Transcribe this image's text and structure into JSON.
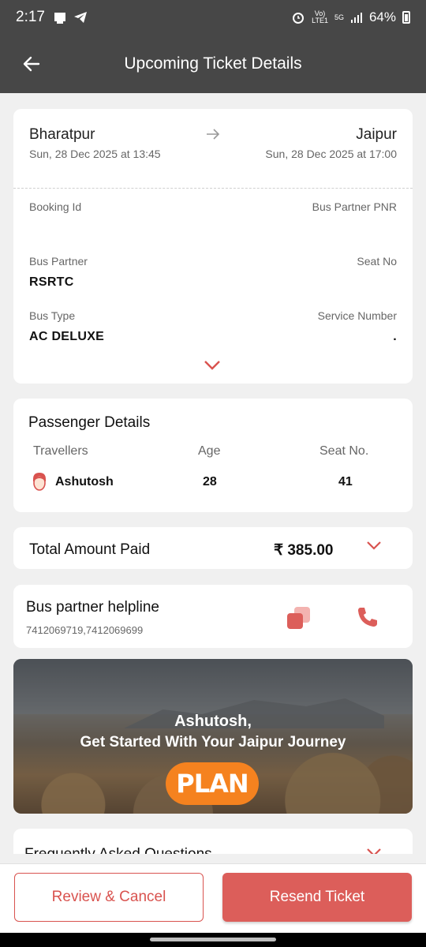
{
  "status": {
    "time": "2:17",
    "battery": "64%",
    "net_top": "Vo)",
    "net_bottom": "LTE1",
    "gen": "5G"
  },
  "header": {
    "title": "Upcoming Ticket Details"
  },
  "journey": {
    "from_city": "Bharatpur",
    "from_datetime": "Sun, 28 Dec 2025 at 13:45",
    "to_city": "Jaipur",
    "to_datetime": "Sun, 28 Dec 2025 at 17:00",
    "booking_id_label": "Booking Id",
    "booking_id_value": "",
    "pnr_label": "Bus Partner PNR",
    "pnr_value": "",
    "partner_label": "Bus Partner",
    "partner_value": "RSRTC",
    "seat_label": "Seat No",
    "seat_value": "",
    "bus_type_label": "Bus Type",
    "bus_type_value": "AC DELUXE",
    "service_label": "Service Number",
    "service_value": "."
  },
  "passenger": {
    "title": "Passenger Details",
    "col_travellers": "Travellers",
    "col_age": "Age",
    "col_seat": "Seat No.",
    "rows": [
      {
        "name": "Ashutosh",
        "age": "28",
        "seat": "41"
      }
    ]
  },
  "payment": {
    "label": "Total Amount Paid",
    "amount": "₹ 385.00"
  },
  "helpline": {
    "label": "Bus partner helpline",
    "numbers": "7412069719,7412069699"
  },
  "banner": {
    "name": "Ashutosh,",
    "text": "Get Started With Your Jaipur Journey",
    "button": "PLAN"
  },
  "faq": {
    "title": "Frequently Asked Questions"
  },
  "actions": {
    "cancel": "Review & Cancel",
    "resend": "Resend Ticket"
  },
  "colors": {
    "accent": "#dc5e5a",
    "header": "#474747",
    "plan": "#f5821f"
  }
}
